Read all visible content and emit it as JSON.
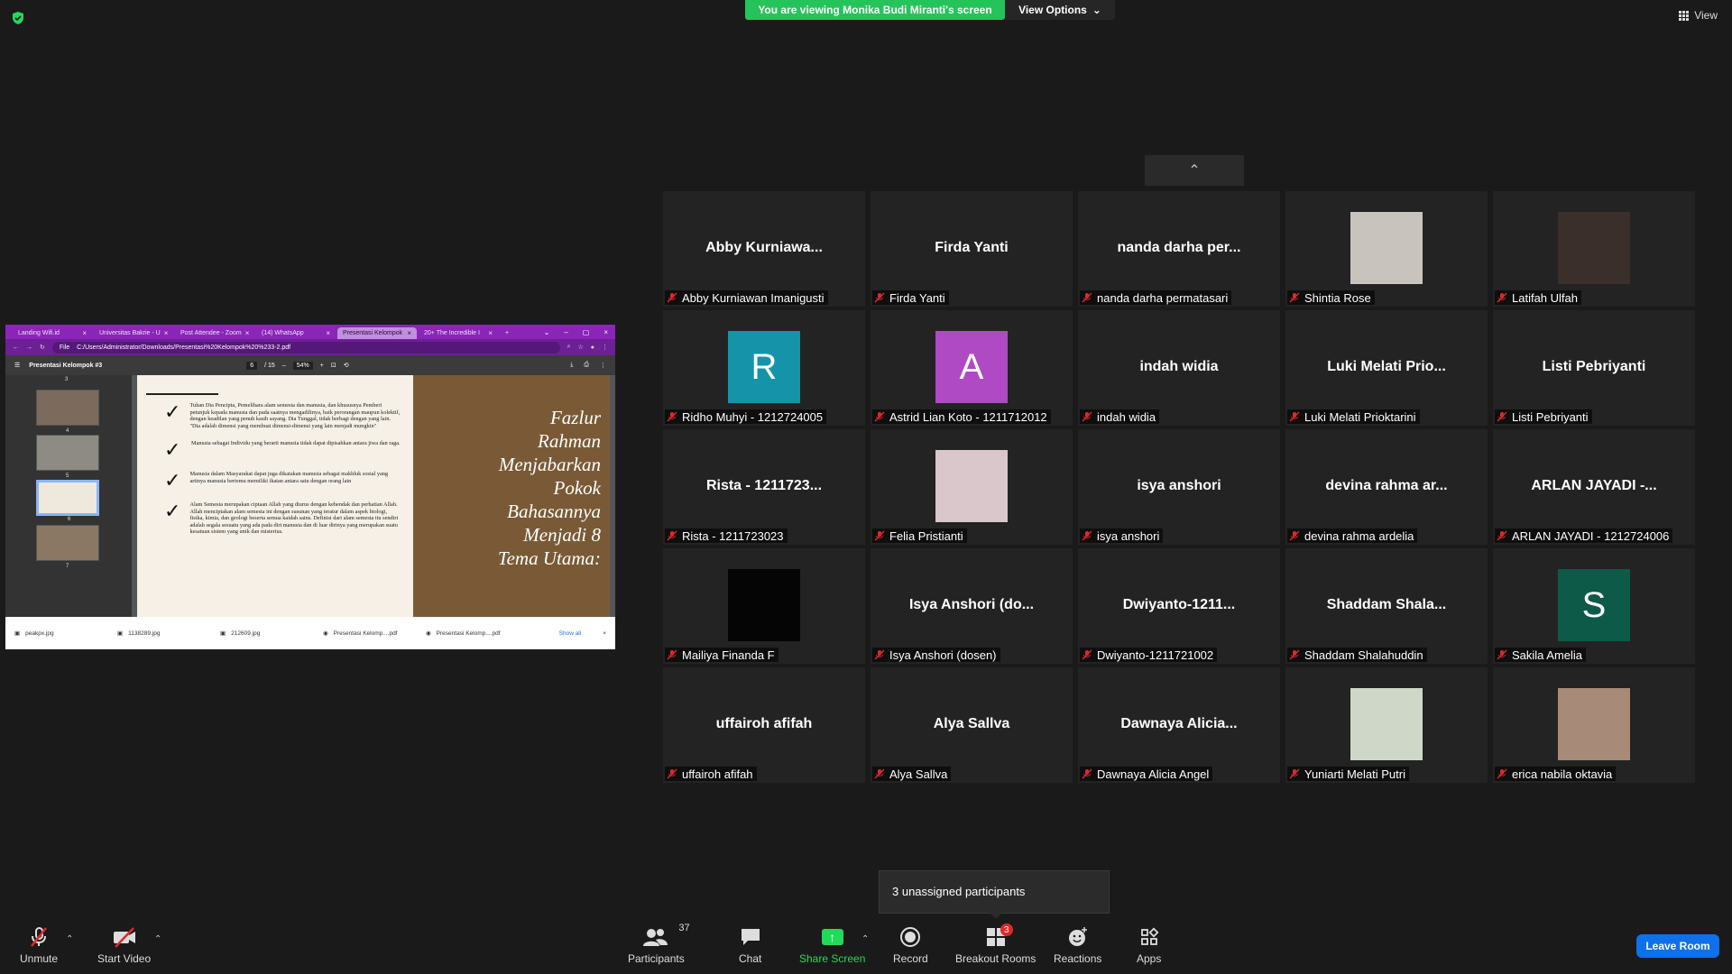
{
  "top": {
    "banner": "You are viewing Monika Budi Miranti's screen",
    "view_options": "View Options",
    "view_label": "View"
  },
  "shared_screen": {
    "tabs": [
      "Landing Wifi.id",
      "Universitas Bakrie - U",
      "Post Attendee - Zoom",
      "(14) WhatsApp",
      "Presentasi Kelompok",
      "20+ The Incredible I"
    ],
    "address": "C:/Users/Administrator/Downloads/Presentasi%20Kelompok%20%233-2.pdf",
    "file_label": "File",
    "pdf_title": "Presentasi Kelompok #3",
    "page_current": "6",
    "page_total": "/ 15",
    "zoom": "54%",
    "thumb_numbers": [
      "3",
      "4",
      "5",
      "6",
      "7"
    ],
    "bullets": [
      "Tuhan Dia Pencipta, Pemelihara alam semesta dan manusia, dan khususnya Pemberi petunjuk kepada manusia dan pada saatnya mengadilinya, baik perorangan maupun kolektif, dengan keadilan yang penuh kasih sayang. Dia Tunggal, tidak berbagi dengan yang lain. \"Dia adalah dimensi yang membuat dimensi-dimensi yang lain menjadi mungkin\"",
      "Manusia sebagai Individu yang berarti manusia tidak dapat dipisahkan antara jiwa dan raga.",
      "Manusia dalam Masyarakat dapat juga dikatakan manusia sebagai makhluk sosial yang artinya manusia bertemu memiliki ikatan antara satu dengan orang lain",
      "Alam Semesta merupakan ciptaan Allah yang diurus dengan kehendak dan perhatian Allah. Allah menciptakan alam semesta ini dengan susunan yang teratur dalam aspek biologi, fisika, kimia, dan geologi beserta semua kaidah sains. Definisi dari alam semesta itu sendiri adalah segala sesuatu yang ada pada diri manusia dan di luar dirinya yang merupakan suatu kesatuan sistem yang unik dan misterius."
    ],
    "slide_title": [
      "Fazlur",
      "Rahman",
      "Menjabarkan",
      "Pokok",
      "Bahasannya",
      "Menjadi 8",
      "Tema Utama:"
    ],
    "downloads": [
      "peakpx.jpg",
      "1138289.jpg",
      "212609.jpg",
      "Presentasi Kelomp....pdf",
      "Presentasi Kelomp....pdf"
    ],
    "show_all": "Show all"
  },
  "participants": [
    {
      "big": "Abby  Kurniawa...",
      "label": "Abby Kurniawan Imanigusti",
      "kind": "name"
    },
    {
      "big": "Firda Yanti",
      "label": "Firda Yanti",
      "kind": "name"
    },
    {
      "big": "nanda  darha  per...",
      "label": "nanda darha permatasari",
      "kind": "name"
    },
    {
      "big": "",
      "label": "Shintia Rose",
      "kind": "photo",
      "photo": "#c9c3be"
    },
    {
      "big": "",
      "label": "Latifah Ulfah",
      "kind": "photo",
      "photo": "#3a2f2a"
    },
    {
      "big": "R",
      "label": "Ridho Muhyi - 1212724005",
      "kind": "avatar",
      "color": "#1593a8"
    },
    {
      "big": "A",
      "label": "Astrid Lian Koto - 1211712012",
      "kind": "avatar",
      "color": "#b04ac4"
    },
    {
      "big": "indah widia",
      "label": "indah widia",
      "kind": "name"
    },
    {
      "big": "Luki  Melati  Prio...",
      "label": "Luki Melati Prioktarini",
      "kind": "name"
    },
    {
      "big": "Listi Pebriyanti",
      "label": "Listi Pebriyanti",
      "kind": "name"
    },
    {
      "big": "Rista - 1211723...",
      "label": "Rista - 1211723023",
      "kind": "name"
    },
    {
      "big": "",
      "label": "Felia Pristianti",
      "kind": "photo",
      "photo": "#d9c7cc"
    },
    {
      "big": "isya anshori",
      "label": "isya anshori",
      "kind": "name"
    },
    {
      "big": "devina  rahma  ar...",
      "label": "devina rahma ardelia",
      "kind": "name"
    },
    {
      "big": "ARLAN JAYADI -...",
      "label": "ARLAN JAYADI - 1212724006",
      "kind": "name"
    },
    {
      "big": "",
      "label": "Mailiya Finanda F",
      "kind": "photo",
      "photo": "#050505"
    },
    {
      "big": "Isya Anshori (do...",
      "label": "Isya Anshori (dosen)",
      "kind": "name"
    },
    {
      "big": "Dwiyanto-1211...",
      "label": "Dwiyanto-1211721002",
      "kind": "name"
    },
    {
      "big": "Shaddam  Shala...",
      "label": "Shaddam Shalahuddin",
      "kind": "name"
    },
    {
      "big": "S",
      "label": "Sakila Amelia",
      "kind": "avatar",
      "color": "#0d5a48"
    },
    {
      "big": "uffairoh afifah",
      "label": "uffairoh afifah",
      "kind": "name"
    },
    {
      "big": "Alya Sallva",
      "label": "Alya Sallva",
      "kind": "name"
    },
    {
      "big": "Dawnaya  Alicia...",
      "label": "Dawnaya Alicia Angel",
      "kind": "name"
    },
    {
      "big": "",
      "label": "Yuniarti Melati Putri",
      "kind": "photo",
      "photo": "#cfd8c8"
    },
    {
      "big": "",
      "label": "erica nabila oktavia",
      "kind": "photo",
      "photo": "#a88a78"
    }
  ],
  "unassigned": "3 unassigned participants",
  "toolbar": {
    "unmute": "Unmute",
    "start_video": "Start Video",
    "participants": "Participants",
    "participants_count": "37",
    "chat": "Chat",
    "share_screen": "Share Screen",
    "record": "Record",
    "breakout_rooms": "Breakout Rooms",
    "breakout_badge": "3",
    "reactions": "Reactions",
    "apps": "Apps",
    "leave": "Leave Room"
  },
  "colors": {
    "banner": "#25c45a",
    "share": "#23d959",
    "leave": "#0e71eb",
    "muted": "#e02828"
  }
}
